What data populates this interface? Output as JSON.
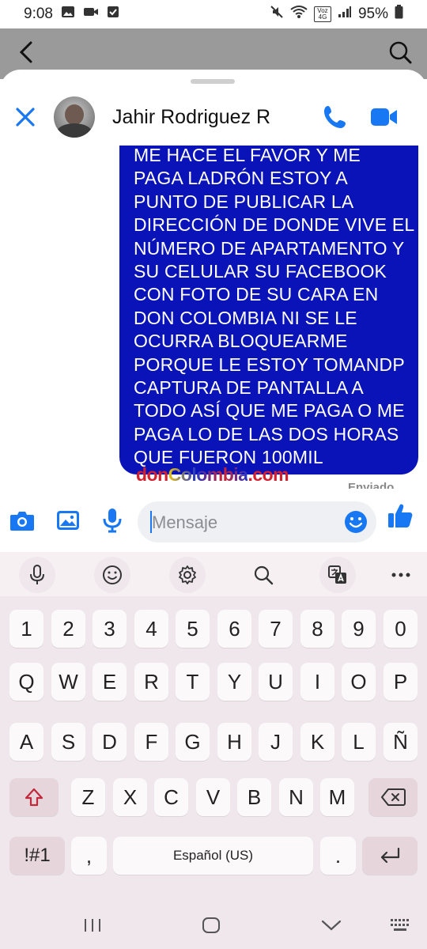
{
  "status_bar": {
    "time": "9:08",
    "battery_percent": "95%",
    "net_label": "Voz 4G"
  },
  "chat": {
    "contact_name": "Jahir Rodriguez R",
    "message_lines": [
      "ME HACE EL FAVOR Y ME",
      "PAGA LADRÓN ESTOY A",
      "PUNTO DE PUBLICAR LA",
      "DIRECCIÓN DE DONDE VIVE EL",
      "NÚMERO DE APARTAMENTO Y",
      "SU CELULAR SU FACEBOOK",
      "CON FOTO DE SU CARA EN",
      "DON COLOMBIA NI SE LE",
      "OCURRA BLOQUEARME",
      "PORQUE LE ESTOY TOMANDP",
      "CAPTURA DE PANTALLA A",
      "TODO ASÍ QUE ME PAGA O ME",
      "PAGA LO DE LAS DOS HORAS",
      "QUE FUERON 100MIL"
    ],
    "sent_label": "Enviado",
    "watermark": {
      "part1": "don",
      "part2": "Colombia",
      "part3": ".com"
    }
  },
  "composer": {
    "placeholder": "Mensaje"
  },
  "keyboard": {
    "rows": [
      [
        "1",
        "2",
        "3",
        "4",
        "5",
        "6",
        "7",
        "8",
        "9",
        "0"
      ],
      [
        "Q",
        "W",
        "E",
        "R",
        "T",
        "Y",
        "U",
        "I",
        "O",
        "P"
      ],
      [
        "A",
        "S",
        "D",
        "F",
        "G",
        "H",
        "J",
        "K",
        "L",
        "Ñ"
      ],
      [
        "Z",
        "X",
        "C",
        "V",
        "B",
        "N",
        "M"
      ]
    ],
    "symbols_key": "!#1",
    "comma_key": ",",
    "space_label": "Español (US)",
    "period_key": "."
  },
  "colors": {
    "brand_blue": "#1877f2",
    "bubble_blue": "#0a13b8",
    "keyboard_bg": "#efe7eb",
    "shift_red": "#c0283c"
  }
}
